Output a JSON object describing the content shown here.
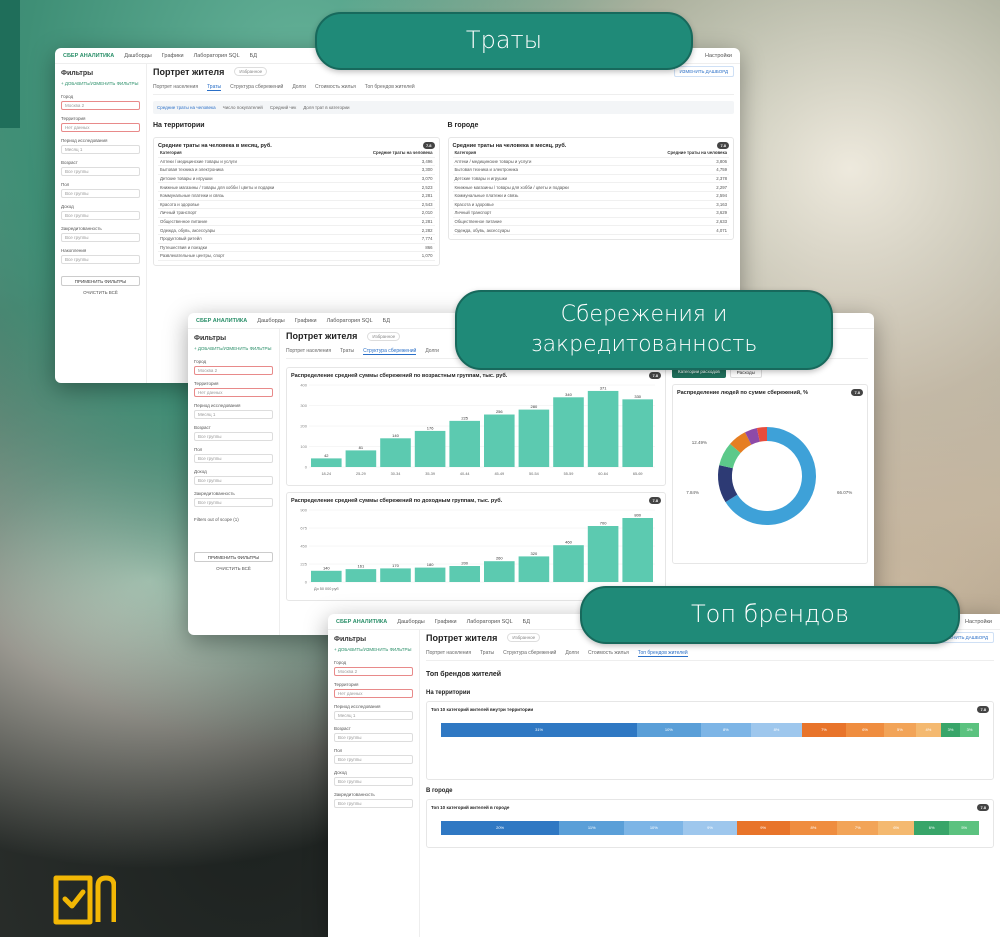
{
  "callouts": {
    "spend": "Траты",
    "savings_line1": "Сбережения и",
    "savings_line2": "закредитованность",
    "brands": "Топ брендов"
  },
  "app": {
    "brand": "СБЕР АНАЛИТИКА",
    "nav": [
      "Дашборды",
      "Графики",
      "Лаборатория SQL",
      "БД"
    ],
    "settings": "Настройки",
    "page_title": "Портрет жителя",
    "favorite": "Избранное",
    "change_dashboard": "ИЗМЕНИТЬ ДАШБОРД",
    "tabs": [
      "Портрет населения",
      "Траты",
      "Структура сбережений",
      "Долги",
      "Стоимость жилья",
      "Топ брендов жителей"
    ]
  },
  "sidebar": {
    "title": "Фильтры",
    "add_filters": "+ ДОБАВИТЬ/ИЗМЕНИТЬ ФИЛЬТРЫ",
    "fields": [
      {
        "label": "Город",
        "value": "Москва 2",
        "red": true
      },
      {
        "label": "Территория",
        "value": "Нет данных",
        "red": true
      },
      {
        "label": "Период исследования",
        "value": "Месяц 1",
        "red": false
      },
      {
        "label": "Возраст",
        "value": "Все группы",
        "red": false
      },
      {
        "label": "Пол",
        "value": "Все группы",
        "red": false
      },
      {
        "label": "Доход",
        "value": "Все группы",
        "red": false
      },
      {
        "label": "Закредитованность",
        "value": "Все группы",
        "red": false
      },
      {
        "label": "Накопления",
        "value": "Все группы",
        "red": false
      }
    ],
    "apply": "ПРИМЕНИТЬ ФИЛЬТРЫ",
    "clear": "ОЧИСТИТЬ ВСЁ",
    "out_of_scope": "Filters out of scope (1)"
  },
  "spend_screen": {
    "subtabs": [
      "Средние траты на человека",
      "Число покупателей",
      "Средний чек",
      "Доля трат в категории"
    ],
    "territory_heading": "На территории",
    "city_heading": "В городе",
    "card_title": "Средние траты на человека в месяц, руб.",
    "col_category": "Категория",
    "col_value": "Средние траты на человека",
    "badge": "7.8",
    "territory_rows": [
      [
        "Аптеки / медицинские товары и услуги",
        "3,496"
      ],
      [
        "Бытовая техника и электроника",
        "3,300"
      ],
      [
        "Детские товары и игрушки",
        "3,070"
      ],
      [
        "Книжные магазины / товары для хобби / цветы и подарки",
        "2,523"
      ],
      [
        "Коммунальные платежи и связь",
        "2,281"
      ],
      [
        "Красота и здоровье",
        "2,543"
      ],
      [
        "Личный транспорт",
        "2,010"
      ],
      [
        "Общественное питание",
        "2,281"
      ],
      [
        "Одежда, обувь, аксессуары",
        "2,282"
      ],
      [
        "Продуктовый ритейл",
        "7,774"
      ],
      [
        "Путешествия и поездки",
        "866"
      ],
      [
        "Развлекательные центры, спорт",
        "1,070"
      ]
    ],
    "city_rows": [
      [
        "Аптеки / медицинские товары и услуги",
        "3,806"
      ],
      [
        "Бытовая техника и электроника",
        "4,759"
      ],
      [
        "Детские товары и игрушки",
        "2,378"
      ],
      [
        "Книжные магазины / товары для хобби / цветы и подарки",
        "2,297"
      ],
      [
        "Коммунальные платежи и связь",
        "2,594"
      ],
      [
        "Красота и здоровье",
        "3,163"
      ],
      [
        "Личный транспорт",
        "3,629"
      ],
      [
        "Общественное питание",
        "2,633"
      ],
      [
        "Одежда, обувь, аксессуары",
        "4,071"
      ]
    ]
  },
  "savings_screen": {
    "chart1_title": "Распределение средней суммы сбережений по возрастным группам, тыс. руб.",
    "chart2_title": "Распределение средней суммы сбережений по доходным группам, тыс. руб.",
    "donut_title": "Распределение людей по сумме сбережений, %",
    "toggle_a": "Категории расходов",
    "toggle_b": "Расходы",
    "badge": "7.8",
    "donut_labels": [
      "12.49%",
      "7.84%",
      "66.07%"
    ]
  },
  "brands_screen": {
    "heading": "Топ брендов жителей",
    "territory": "На территории",
    "city": "В городе",
    "card1_title": "Топ 10 категорий жителей внутри территории",
    "card2_title": "Топ 10 категорий жителей в городе",
    "bar1_labels": [
      "31%",
      "10%",
      "8%",
      "8%",
      "7%",
      "6%",
      "5%",
      "4%",
      "3%",
      "3%"
    ],
    "bar2_labels": [
      "20%",
      "11%",
      "10%",
      "9%",
      "9%",
      "8%",
      "7%",
      "6%",
      "6%",
      "5%"
    ]
  },
  "chart_data": [
    {
      "type": "bar",
      "title": "Распределение средней суммы сбережений по возрастным группам, тыс. руб.",
      "categories": [
        "18-24",
        "25-29",
        "30-34",
        "35-39",
        "40-44",
        "45-49",
        "50-54",
        "55-59",
        "60-64",
        "65-69"
      ],
      "values": [
        42,
        81,
        140,
        176,
        225,
        256,
        280,
        340,
        371,
        330
      ],
      "ylim": [
        0,
        400
      ]
    },
    {
      "type": "bar",
      "title": "Распределение средней суммы сбережений по доходным группам, тыс. руб.",
      "categories": [
        "До 50 000 руб",
        "",
        "",
        "",
        "",
        "",
        "",
        "",
        "",
        ""
      ],
      "values": [
        140,
        161,
        170,
        180,
        200,
        260,
        320,
        460,
        700,
        800
      ],
      "ylim": [
        0,
        900
      ]
    },
    {
      "type": "pie",
      "title": "Распределение людей по сумме сбережений, %",
      "values": [
        66.07,
        12.49,
        7.84,
        6.2,
        4.1,
        3.3
      ]
    }
  ],
  "colors": {
    "teal_bar": "#5ccab0",
    "pill_bg": "#1f8a78",
    "donut": [
      "#3ea1d8",
      "#2d3a74",
      "#5cc98a",
      "#e67e22",
      "#8e4aa8",
      "#e74c3c"
    ],
    "brand_bar1": [
      "#2f78c3",
      "#5a9fd8",
      "#7db5e6",
      "#9ec7ed",
      "#e8742a",
      "#ef8d3f",
      "#f2a458",
      "#f4b970",
      "#38a569",
      "#5bc27f"
    ]
  }
}
